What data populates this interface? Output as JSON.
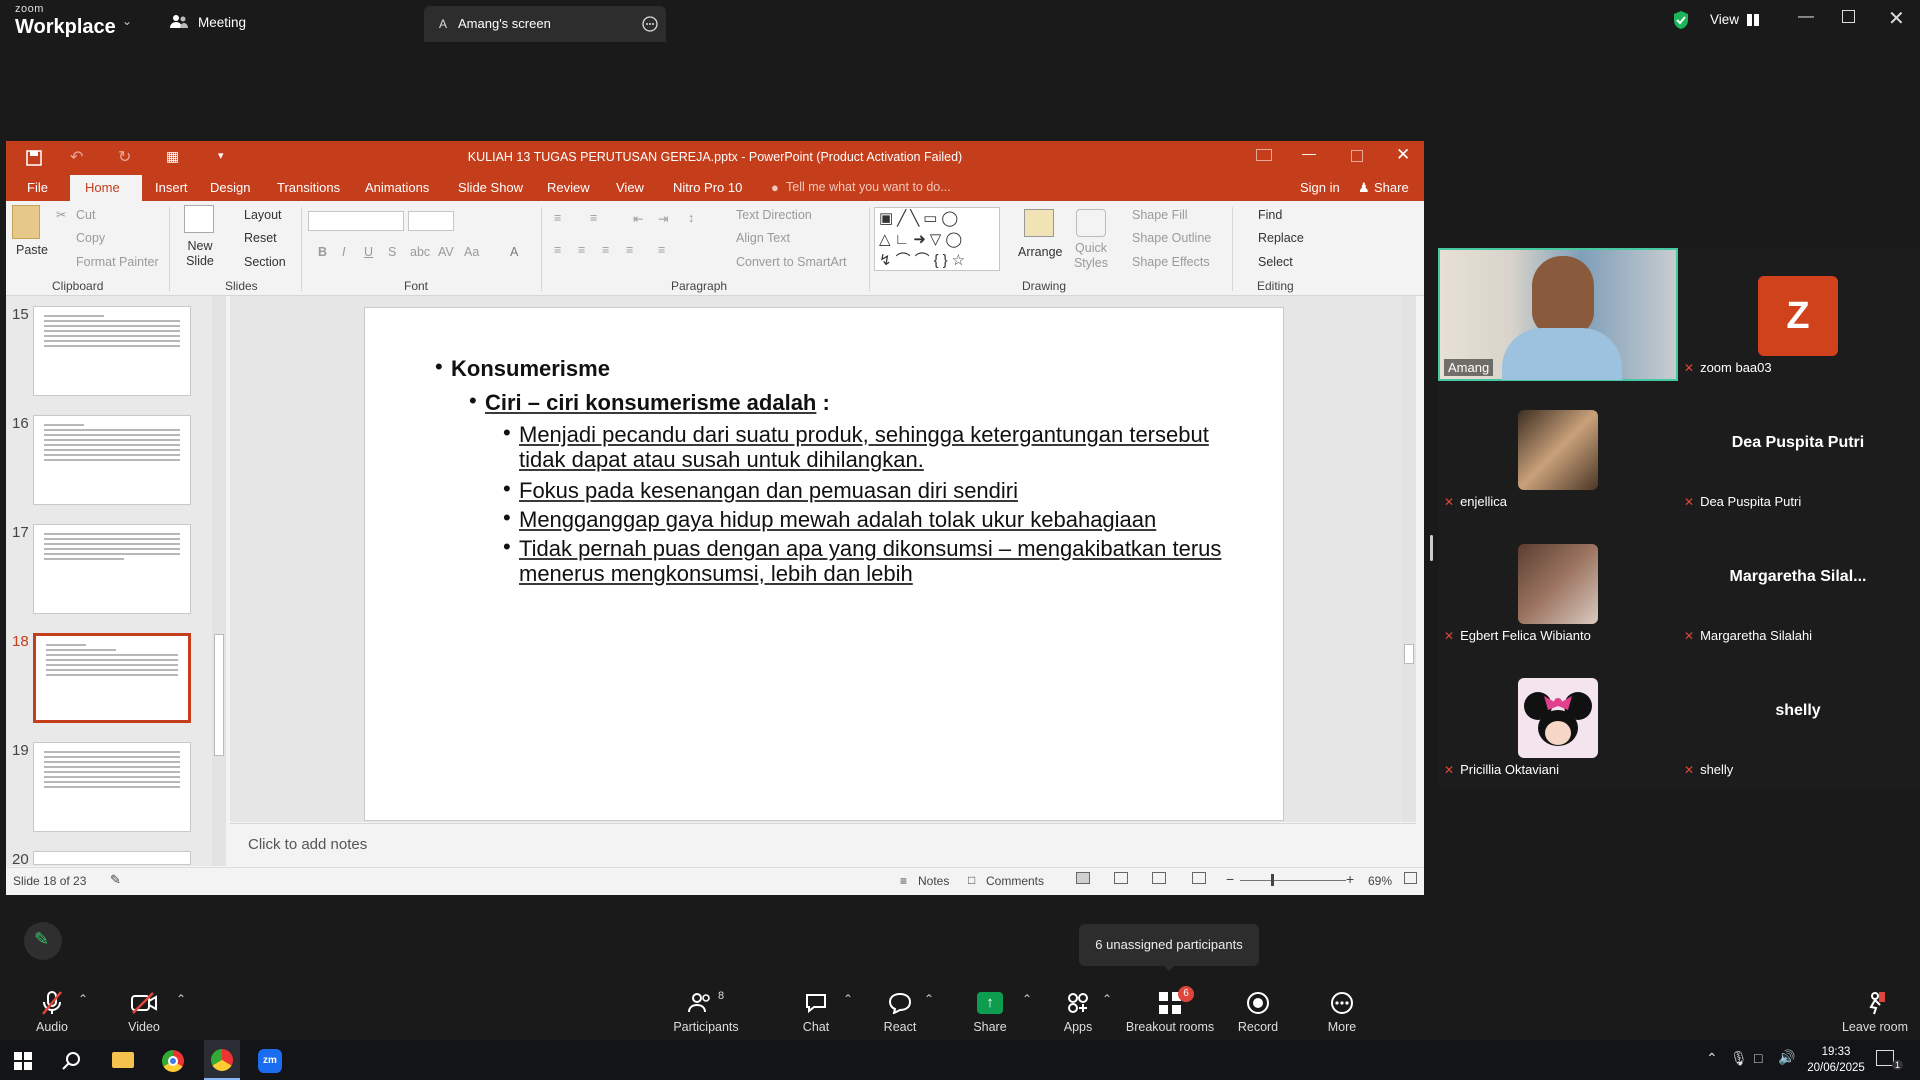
{
  "zoom": {
    "brand_small": "zoom",
    "brand_big": "Workplace",
    "meeting_label": "Meeting",
    "share_avatar": "A",
    "share_tab": "Amang's screen",
    "view_label": "View"
  },
  "ppt": {
    "title": "KULIAH 13 TUGAS PERUTUSAN GEREJA.pptx - PowerPoint (Product Activation Failed)",
    "tabs": [
      "File",
      "Home",
      "Insert",
      "Design",
      "Transitions",
      "Animations",
      "Slide Show",
      "Review",
      "View",
      "Nitro Pro 10"
    ],
    "tell_me": "Tell me what you want to do...",
    "signin": "Sign in",
    "share": "Share",
    "ribbon": {
      "paste": "Paste",
      "cut": "Cut",
      "copy": "Copy",
      "format_painter": "Format Painter",
      "new_slide": "New Slide",
      "layout": "Layout",
      "reset": "Reset",
      "section": "Section",
      "text_direction": "Text Direction",
      "align_text": "Align Text",
      "convert_smartart": "Convert to SmartArt",
      "arrange": "Arrange",
      "quick_styles": "Quick Styles",
      "shape_fill": "Shape Fill",
      "shape_outline": "Shape Outline",
      "shape_effects": "Shape Effects",
      "find": "Find",
      "replace": "Replace",
      "select": "Select",
      "groups": [
        "Clipboard",
        "Slides",
        "Font",
        "Paragraph",
        "Drawing",
        "Editing"
      ]
    },
    "thumb_numbers": [
      "15",
      "16",
      "17",
      "18",
      "19",
      "20"
    ],
    "slide": {
      "h1": "Konsumerisme",
      "h2": "Ciri – ciri konsumerisme adalah",
      "h2_suffix": " :",
      "bullets": [
        [
          "Menjadi pecandu dari suatu produk, sehingga ketergantungan tersebut",
          "tidak dapat atau susah untuk dihilangkan."
        ],
        [
          "Fokus pada kesenangan dan pemuasan diri sendiri"
        ],
        [
          "Mengganggap gaya hidup mewah adalah tolak ukur kebahagiaan"
        ],
        [
          "Tidak pernah puas dengan apa yang dikonsumsi – mengakibatkan terus",
          "menerus mengkonsumsi, lebih dan lebih"
        ]
      ]
    },
    "notes_placeholder": "Click to add notes",
    "status": {
      "slide_of": "Slide 18 of 23",
      "notes": "Notes",
      "comments": "Comments",
      "zoom": "69%"
    }
  },
  "participants": [
    {
      "name": "Amang",
      "kind": "video"
    },
    {
      "name": "zoom baa03",
      "kind": "avatar",
      "letter": "Z",
      "color": "#d0421b"
    },
    {
      "name": "enjellica",
      "kind": "photo"
    },
    {
      "name": "Dea Puspita Putri",
      "kind": "text",
      "display": "Dea Puspita Putri"
    },
    {
      "name": "Egbert Felica Wibianto",
      "kind": "photo"
    },
    {
      "name": "Margaretha Silalahi",
      "kind": "text",
      "display": "Margaretha Silal..."
    },
    {
      "name": "Pricillia Oktaviani",
      "kind": "photo"
    },
    {
      "name": "shelly",
      "kind": "text",
      "display": "shelly"
    }
  ],
  "tooltip": "6 unassigned participants",
  "toolbar": {
    "audio": "Audio",
    "video": "Video",
    "participants": "Participants",
    "participants_count": "8",
    "chat": "Chat",
    "react": "React",
    "share": "Share",
    "apps": "Apps",
    "breakout": "Breakout rooms",
    "breakout_badge": "6",
    "record": "Record",
    "more": "More",
    "leave": "Leave room"
  },
  "taskbar": {
    "time": "19:33",
    "date": "20/06/2025",
    "notif_count": "1"
  },
  "colors": {
    "ppt_red": "#c43e1c",
    "zoom_green": "#0e9d4e",
    "speaker_border": "#46c8a0"
  }
}
